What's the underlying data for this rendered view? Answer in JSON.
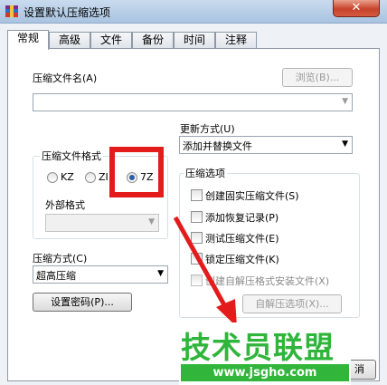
{
  "window": {
    "title": "设置默认压缩选项",
    "close_glyph": "✕"
  },
  "tabs": [
    "常规",
    "高级",
    "文件",
    "备份",
    "时间",
    "注释"
  ],
  "archive_name": {
    "label": "压缩文件名(A)",
    "value": "",
    "browse_label": "浏览(B)..."
  },
  "update_mode": {
    "label": "更新方式(U)",
    "value": "添加并替换文件"
  },
  "archive_format": {
    "label": "压缩文件格式",
    "options": [
      "KZ",
      "ZI",
      "7Z"
    ],
    "selected": "7Z",
    "external_label": "外部格式",
    "external_value": ""
  },
  "compression_method": {
    "label": "压缩方式(C)",
    "value": "超高压缩"
  },
  "password_button": "设置密码(P)...",
  "compression_options": {
    "title": "压缩选项",
    "items": [
      {
        "label": "创建固实压缩文件(S)",
        "enabled": true
      },
      {
        "label": "添加恢复记录(P)",
        "enabled": true
      },
      {
        "label": "测试压缩文件(E)",
        "enabled": true
      },
      {
        "label": "锁定压缩文件(K)",
        "enabled": true
      },
      {
        "label": "创建自解压格式安装文件(X)",
        "enabled": false
      }
    ],
    "sfx_button": "自解压选项(X)..."
  },
  "ok_partial": "消",
  "watermark": {
    "title": "技术员联盟",
    "url": "www.jsgho.com"
  },
  "annotation_color": "#e31b1b",
  "watermark_color": "#2fb53a"
}
